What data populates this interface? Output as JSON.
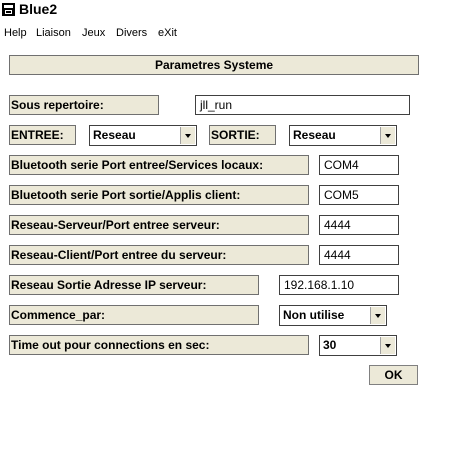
{
  "window": {
    "title": "Blue2",
    "icon": "app-icon"
  },
  "menu": [
    "Help",
    "Liaison",
    "Jeux",
    "Divers",
    "eXit"
  ],
  "panel": {
    "header": "Parametres Systeme"
  },
  "fields": {
    "sous_repertoire": {
      "label": "Sous repertoire:",
      "value": "jll_run"
    },
    "entree": {
      "label": "ENTREE:",
      "value": "Reseau"
    },
    "sortie": {
      "label": "SORTIE:",
      "value": "Reseau"
    },
    "bt_in": {
      "label": "Bluetooth serie Port entree/Services locaux:",
      "value": "COM4"
    },
    "bt_out": {
      "label": "Bluetooth serie Port sortie/Applis client:",
      "value": "COM5"
    },
    "net_server": {
      "label": "Reseau-Serveur/Port entree serveur:",
      "value": "4444"
    },
    "net_client": {
      "label": "Reseau-Client/Port entree du serveur:",
      "value": "4444"
    },
    "ip": {
      "label": "Reseau Sortie Adresse IP serveur:",
      "value": "192.168.1.10"
    },
    "commence": {
      "label": "Commence_par:",
      "value": "Non utilise"
    },
    "timeout": {
      "label": "Time out pour connections en sec:",
      "value": "30"
    }
  },
  "ok_label": "OK"
}
